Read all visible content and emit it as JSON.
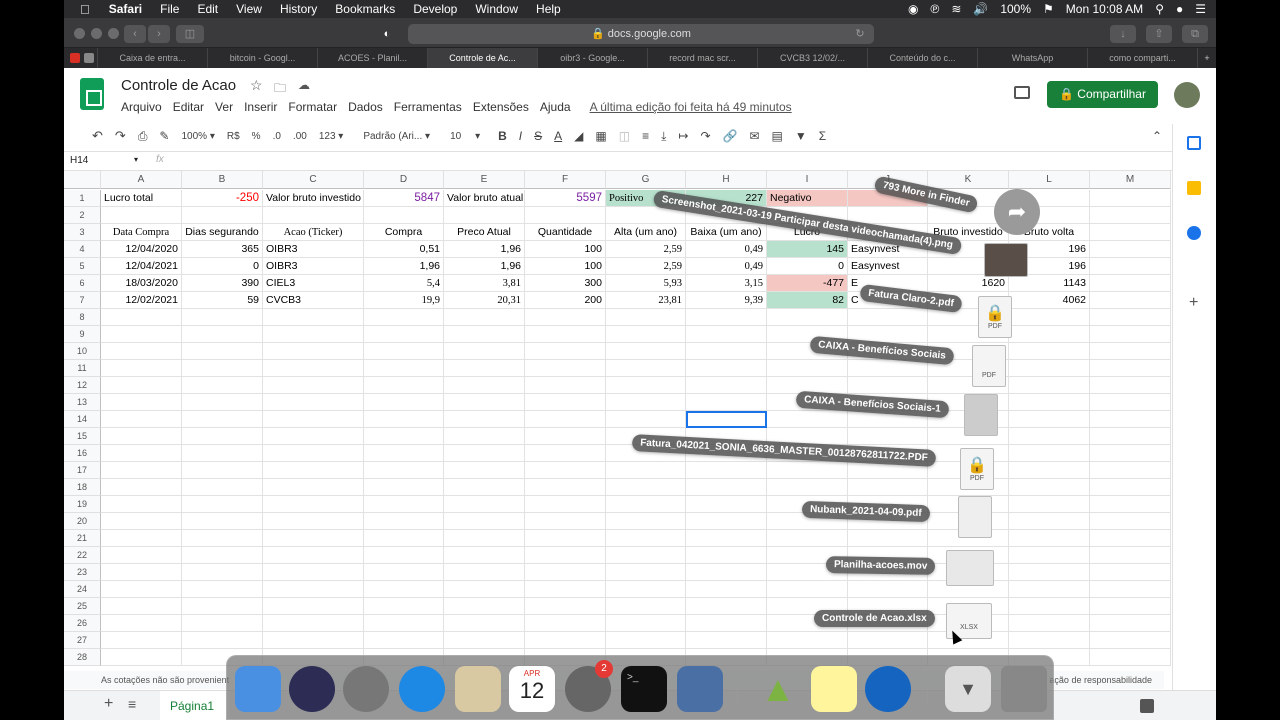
{
  "menubar": {
    "app": "Safari",
    "items": [
      "File",
      "Edit",
      "View",
      "History",
      "Bookmarks",
      "Develop",
      "Window",
      "Help"
    ],
    "battery": "100%",
    "clock": "Mon 10:08 AM"
  },
  "safari": {
    "url": "docs.google.com",
    "tabs": [
      "Caixa de entra...",
      "bitcoin - Googl...",
      "ACOES - Planil...",
      "Controle de Ac...",
      "oibr3 - Google...",
      "record mac scr...",
      "CVCB3 12/02/...",
      "Conteúdo do c...",
      "WhatsApp",
      "como comparti..."
    ],
    "active_tab_index": 3
  },
  "doc": {
    "title": "Controle de Acao",
    "menu": [
      "Arquivo",
      "Editar",
      "Ver",
      "Inserir",
      "Formatar",
      "Dados",
      "Ferramentas",
      "Extensões",
      "Ajuda"
    ],
    "last_edit": "A última edição foi feita há 49 minutos",
    "share": "Compartilhar"
  },
  "format_toolbar": {
    "zoom": "100%",
    "currency": "R$",
    "percent": "%",
    "dec_less": ".0",
    "dec_more": ".00",
    "num_format": "123",
    "font": "Padrão (Ari...",
    "font_size": "10",
    "bold": "B",
    "italic": "I",
    "strike": "S",
    "text_color": "A"
  },
  "formula": {
    "name_box": "H14",
    "fx": "fx"
  },
  "columns": [
    "A",
    "B",
    "C",
    "D",
    "E",
    "F",
    "G",
    "H",
    "I",
    "J",
    "K",
    "L",
    "M"
  ],
  "rows": [
    "1",
    "2",
    "3",
    "4",
    "5",
    "6",
    "7",
    "8",
    "9",
    "10",
    "11",
    "12",
    "13",
    "14",
    "15",
    "16",
    "17",
    "18",
    "19",
    "20",
    "21",
    "22",
    "23",
    "24",
    "25",
    "26",
    "27",
    "28"
  ],
  "cells": {
    "A1": "Lucro total",
    "B1": "-250",
    "C1": "Valor bruto investido",
    "D1": "5847",
    "E1": "Valor bruto atual",
    "F1": "5597",
    "G1": "Positivo",
    "H1": "227",
    "I1": "Negativo",
    "A3": "Data Compra",
    "B3": "Dias segurando",
    "C3": "Acao (Ticker)",
    "D3": "Compra",
    "E3": "Preco Atual",
    "F3": "Quantidade",
    "G3": "Alta (um ano)",
    "H3": "Baixa (um ano)",
    "I3": "Lucro",
    "K3": "Bruto investido",
    "L3": "Bruto volta",
    "A4": "12/04/2020",
    "B4": "365",
    "C4": "OIBR3",
    "D4": "0,51",
    "E4": "1,96",
    "F4": "100",
    "G4": "2,59",
    "H4": "0,49",
    "I4": "145",
    "J4": "Easynvest",
    "L4": "196",
    "A5": "12/04/2021",
    "B5": "0",
    "C5": "OIBR3",
    "D5": "1,96",
    "E5": "1,96",
    "F5": "100",
    "G5": "2,59",
    "H5": "0,49",
    "I5": "0",
    "J5": "Easynvest",
    "L5": "196",
    "A6": "18/03/2020",
    "B6": "390",
    "C6": "CIEL3",
    "D6": "5,4",
    "E6": "3,81",
    "F6": "300",
    "G6": "5,93",
    "H6": "3,15",
    "I6": "-477",
    "J6": "E",
    "K6": "1620",
    "L6": "1143",
    "A7": "12/02/2021",
    "B7": "59",
    "C7": "CVCB3",
    "D7": "19,9",
    "E7": "20,31",
    "F7": "200",
    "G7": "23,81",
    "H7": "9,39",
    "I7": "82",
    "J7": "C",
    "L7": "4062"
  },
  "status": {
    "left": "As cotações não são provenient",
    "right": "ação de responsabilidade"
  },
  "sheet_tab": "Página1",
  "stack": {
    "more": "793 More in Finder",
    "files": [
      "Screenshot_2021-03-19 Participar desta videochamada(4).png",
      "Fatura Claro-2.pdf",
      "CAIXA - Benefícios Sociais",
      "CAIXA - Benefícios Sociais-1",
      "Fatura_042021_SONIA_6636_MASTER_00128762811722.PDF",
      "Nubank_2021-04-09.pdf",
      "Planilha-acoes.mov",
      "Controle de Acao.xlsx"
    ],
    "icon_labels": [
      "PDF",
      "PDF",
      "PDF",
      "XLSX"
    ]
  },
  "dock": {
    "calendar_month": "APR",
    "calendar_day": "12",
    "badge": "2"
  },
  "colors": {
    "green_cell": "#b7e1cd",
    "red_cell": "#f4c7c3",
    "negative_text": "#ff0000",
    "purple_text": "#7b1fa2",
    "share_green": "#188038"
  }
}
